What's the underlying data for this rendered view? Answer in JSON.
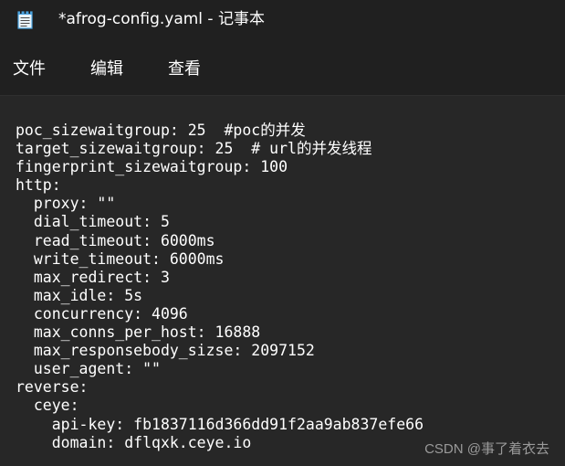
{
  "window": {
    "title": "*afrog-config.yaml - 记事本",
    "app_icon": "notepad-icon"
  },
  "menu": {
    "file": "文件",
    "edit": "编辑",
    "view": "查看"
  },
  "editor": {
    "lines": [
      "poc_sizewaitgroup: 25  #poc的并发",
      "target_sizewaitgroup: 25  # url的并发线程",
      "fingerprint_sizewaitgroup: 100",
      "http:",
      "  proxy: \"\"",
      "  dial_timeout: 5",
      "  read_timeout: 6000ms",
      "  write_timeout: 6000ms",
      "  max_redirect: 3",
      "  max_idle: 5s",
      "  concurrency: 4096",
      "  max_conns_per_host: 16888",
      "  max_responsebody_sizse: 2097152",
      "  user_agent: \"\"",
      "reverse:",
      "  ceye:",
      "    api-key: fb1837116d366dd91f2aa9ab837efe66",
      "    domain: dflqxk.ceye.io"
    ]
  },
  "watermark": "CSDN @事了着衣去"
}
